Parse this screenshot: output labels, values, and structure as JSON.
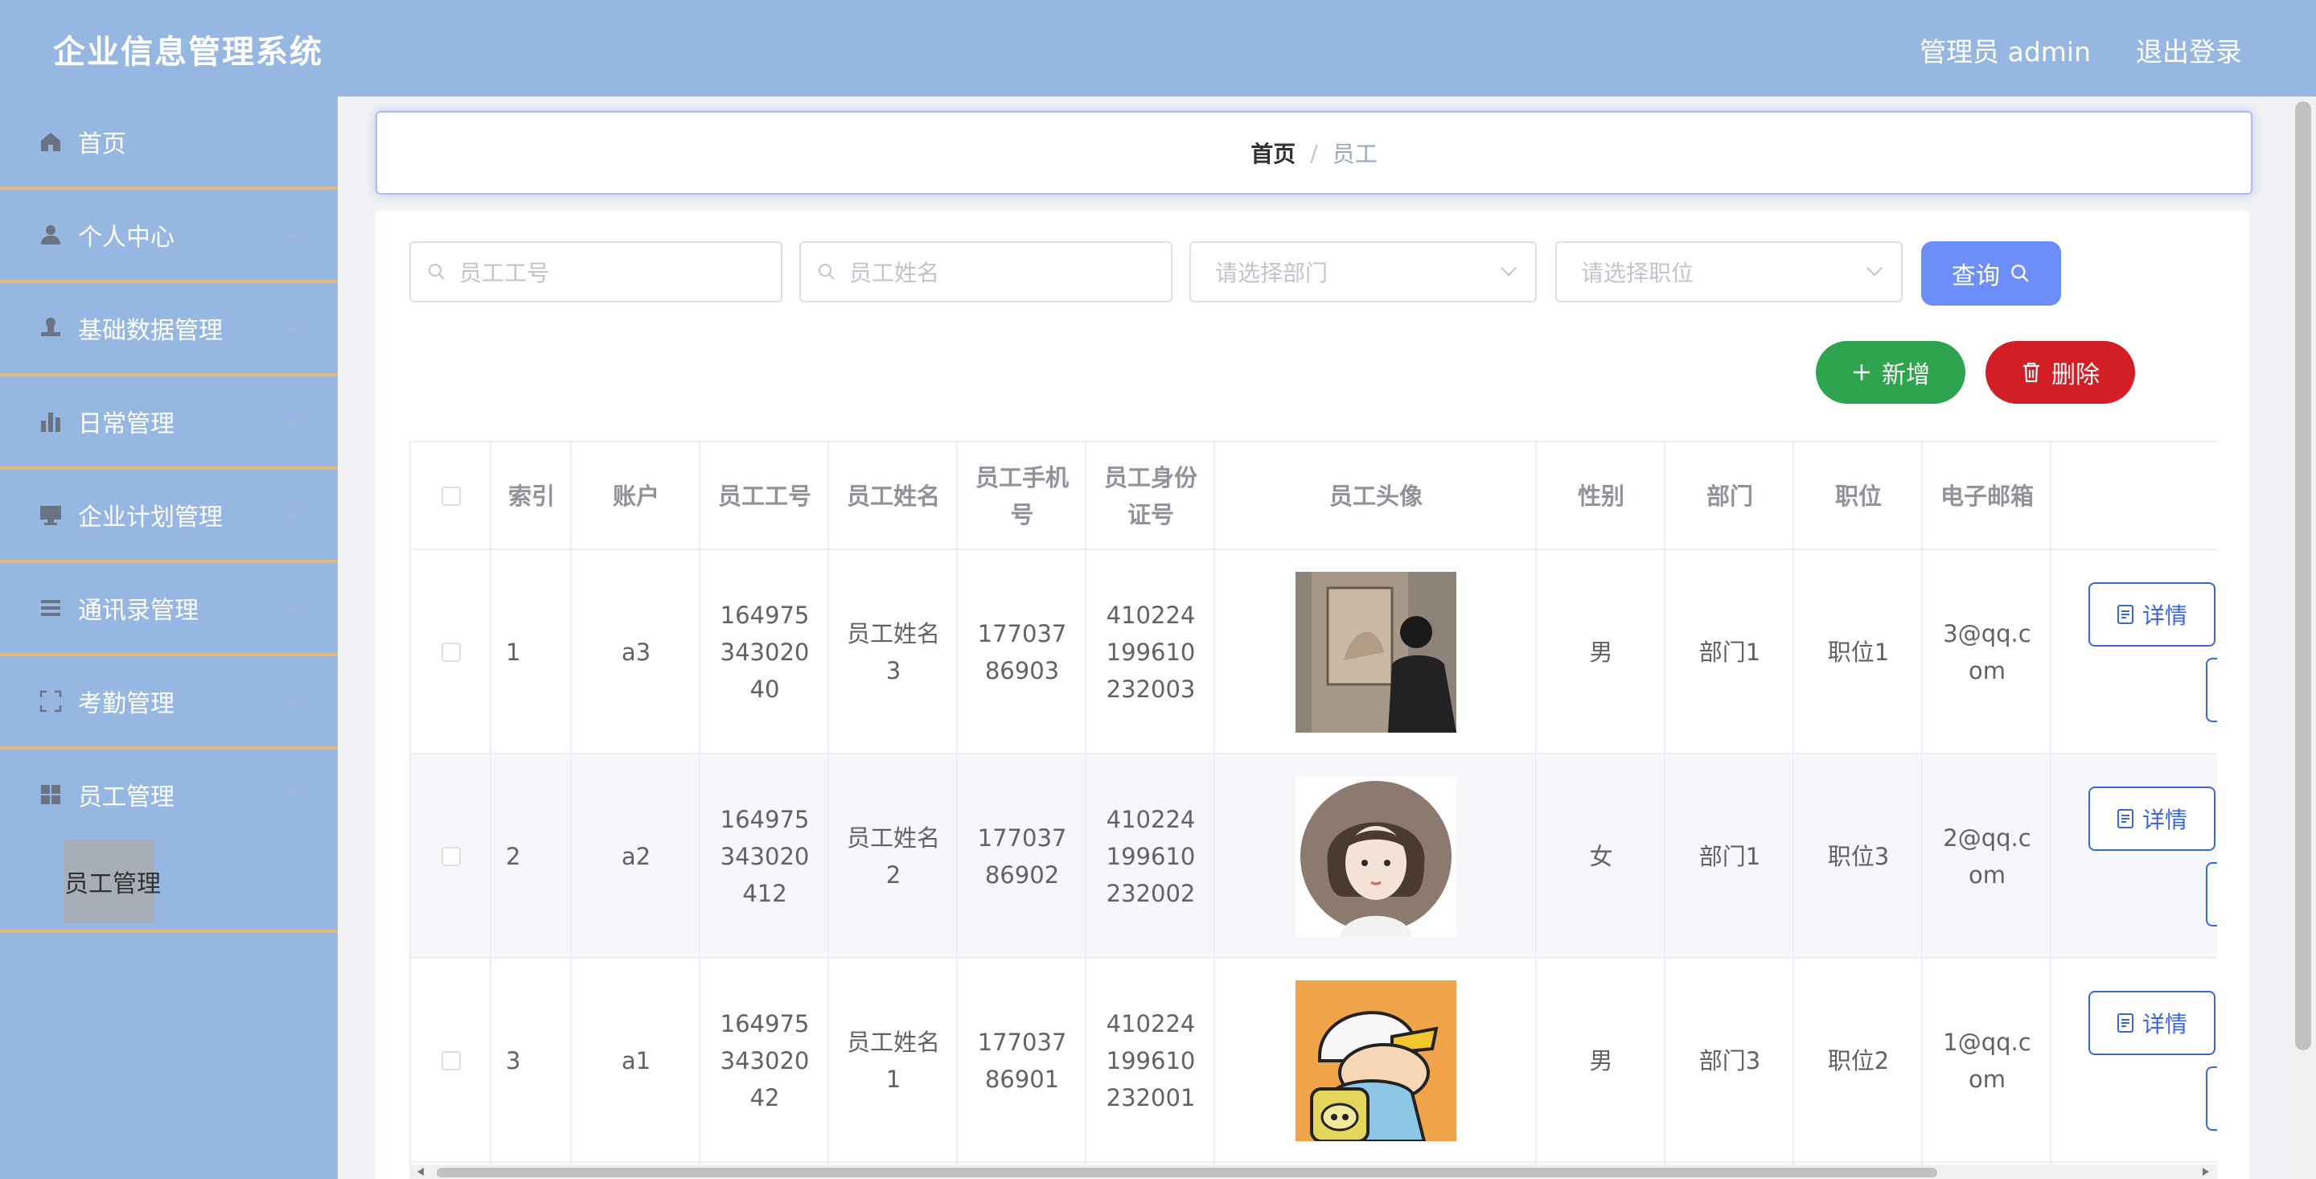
{
  "header": {
    "title": "企业信息管理系统",
    "user": "管理员 admin",
    "logout": "退出登录"
  },
  "sidebar": {
    "items": [
      {
        "label": "首页",
        "icon": "home-icon"
      },
      {
        "label": "个人中心",
        "icon": "user-icon"
      },
      {
        "label": "基础数据管理",
        "icon": "stamp-icon"
      },
      {
        "label": "日常管理",
        "icon": "bar-chart-icon"
      },
      {
        "label": "企业计划管理",
        "icon": "monitor-icon"
      },
      {
        "label": "通讯录管理",
        "icon": "list-icon"
      },
      {
        "label": "考勤管理",
        "icon": "fullscreen-icon"
      },
      {
        "label": "员工管理",
        "icon": "grid-icon"
      }
    ],
    "active_sub": "员工管理"
  },
  "breadcrumb": {
    "home": "首页",
    "separator": "/",
    "current": "员工"
  },
  "filters": {
    "emp_no_placeholder": "员工工号",
    "emp_name_placeholder": "员工姓名",
    "dept_placeholder": "请选择部门",
    "position_placeholder": "请选择职位",
    "query_label": "查询"
  },
  "actions": {
    "add_label": "新增",
    "delete_label": "删除"
  },
  "table": {
    "headers": {
      "index": "索引",
      "account": "账户",
      "emp_no": "员工工号",
      "name": "员工姓名",
      "phone": "员工手机号",
      "id_card": "员工身份证号",
      "avatar": "员工头像",
      "gender": "性别",
      "dept": "部门",
      "position": "职位",
      "email": "电子邮箱"
    },
    "detail_label": "详情",
    "rows": [
      {
        "index": "1",
        "account": "a3",
        "emp_no": "16497534302040",
        "name": "员工姓名3",
        "phone": "17703786903",
        "id_card": "410224199610232003",
        "gender": "男",
        "dept": "部门1",
        "position": "职位1",
        "email": "3@qq.com"
      },
      {
        "index": "2",
        "account": "a2",
        "emp_no": "164975343020412",
        "name": "员工姓名2",
        "phone": "17703786902",
        "id_card": "410224199610232002",
        "gender": "女",
        "dept": "部门1",
        "position": "职位3",
        "email": "2@qq.com"
      },
      {
        "index": "3",
        "account": "a1",
        "emp_no": "16497534302042",
        "name": "员工姓名1",
        "phone": "17703786901",
        "id_card": "410224199610232001",
        "gender": "男",
        "dept": "部门3",
        "position": "职位2",
        "email": "1@qq.com"
      }
    ]
  },
  "colors": {
    "header_bg": "#96b7e2",
    "primary": "#6d8ef8",
    "success": "#2ea44f",
    "danger": "#d21f25",
    "menu_border": "#e2b977"
  }
}
